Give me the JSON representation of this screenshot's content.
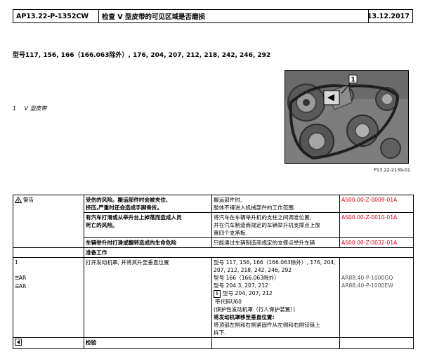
{
  "header": {
    "doc_id": "AP13.22-P-1352CW",
    "title": "检查 V 型皮带的可见区域是否磨损",
    "date": "13.12.2017"
  },
  "models_line": "型号117, 156, 166（166.063除外）, 176, 204, 207, 212, 218, 242, 246, 292",
  "legend": {
    "num": "1",
    "text": "V 型皮带"
  },
  "figure": {
    "callout": "1",
    "code": "P13.22-2139-01"
  },
  "table": {
    "r1": {
      "label": "警告",
      "c2a": "受伤的风险。搬运部件时会被夹住、",
      "c2b": "挤压,严重时还会造成手脚骨折。",
      "c3a": "搬运部件时,",
      "c3b": "肢体不得进入机械部件的工作范围.",
      "code": "AS00.00-Z-0009-01A"
    },
    "r2": {
      "c2a": "有汽车打滑或从举升台上掉落而造成人员",
      "c2b": "死亡的风险。",
      "c3a": "将汽车在车辆举升机的支柱之间调准位置,",
      "c3b": "并在汽车制造商规定的车辆举升机支撑点上放",
      "c3c": "置四个支承板.",
      "code": "AS00.00-Z-0010-01A"
    },
    "r3": {
      "c2": "车辆举升时打滑或翻转造成的生命危险",
      "c3": "只能通过车辆制造商规定的支撑点举升车辆",
      "code": "AS00.00-Z-0032-01A"
    },
    "prep": "准备工作",
    "r4": {
      "step": "1",
      "ar1": "AR",
      "ar2": "AR",
      "action": "打开发动机罩, 并将其升至垂直位置",
      "m1": "型号 117, 156, 166（166.063除外）, 176, 204,",
      "m2": "207, 212, 218, 242, 246, 292",
      "m3": "型号 166（166.063除外）",
      "m4": "型号 204.3, 207, 212",
      "m5": "型号 204, 207, 212",
      "m6": "带代码U60",
      "m7": "(保护性发动机罩（行人保护装置）)",
      "m8": "将发动机罩移至垂直位置:",
      "m9": "将顶部左侧和右侧紧固件从左侧和右侧铰链上",
      "m10": "拆下.",
      "ref1": "AR88.40-P-1000GQ",
      "ref2": "AR88.40-P-1000EW",
      "info_letter": "i"
    },
    "r5": {
      "c2": "检验"
    }
  }
}
